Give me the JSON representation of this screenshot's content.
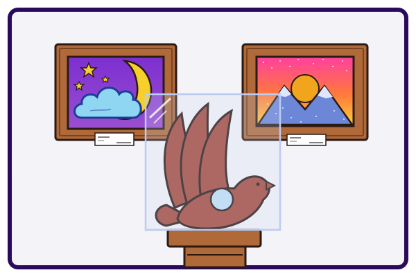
{
  "scene": {
    "subject": "museum-gallery",
    "colors": {
      "outer_frame": "#2a0a5a",
      "wall": "#f4f3f7",
      "wood_frame": "#b06a3a",
      "wood_dark": "#7a4320",
      "night_sky": "#8b3fc7",
      "moon": "#f6cf2a",
      "cloud": "#8fd6f2",
      "sunset_top": "#ff3fa0",
      "sunset_bottom": "#ffd23a",
      "mountain": "#6c86d8",
      "bird_sculpture": "#a64a3c",
      "orb": "#bfe0f5",
      "glass_case": "#c9d4f4",
      "pedestal": "#b06a3a"
    }
  },
  "left_painting": {
    "theme": "night-moon-cloud-stars",
    "icons": [
      "moon-icon",
      "cloud-icon",
      "star-icon"
    ]
  },
  "right_painting": {
    "theme": "sunset-mountains",
    "icons": [
      "sun-icon",
      "mountain-icon"
    ]
  },
  "sculpture": {
    "theme": "phoenix-bird",
    "icon": "bird-icon"
  }
}
